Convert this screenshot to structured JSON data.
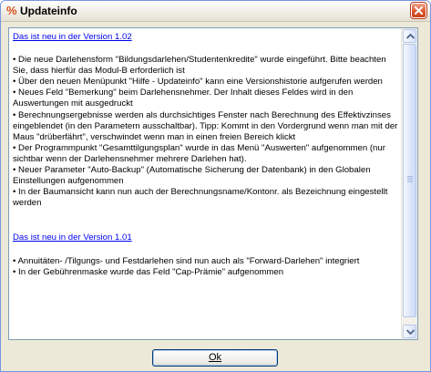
{
  "window": {
    "title": "Updateinfo",
    "app_icon": "percent-icon",
    "close_icon": "close-icon"
  },
  "content": {
    "sections": [
      {
        "heading": "Das ist neu in der Version 1.02",
        "items": [
          "• Die neue Darlehensform \"Bildungsdarlehen/Studentenkredite\" wurde eingeführt. Bitte beachten Sie, dass hierfür das Modul-B erforderlich ist",
          "• Über den neuen Menüpunkt \"Hilfe - Updateinfo\" kann eine Versionshistorie aufgerufen werden",
          "• Neues Feld \"Bemerkung\" beim Darlehensnehmer. Der Inhalt dieses Feldes wird in den Auswertungen mit ausgedruckt",
          "• Berechnungsergebnisse werden als durchsichtiges Fenster nach Berechnung des Effektivzinses eingeblendet (in den Parametern ausschaltbar). Tipp: Kommt in den Vordergrund wenn man mit der Maus \"drüberfährt\", verschwindet wenn man in einen freien Bereich klickt",
          "• Der Programmpunkt \"Gesamttilgungsplan\" wurde in das Menü \"Auswerten\" aufgenommen (nur sichtbar wenn der Darlehensnehmer mehrere Darlehen hat).",
          "• Neuer Parameter \"Auto-Backup\" (Automatische Sicherung der Datenbank) in den Globalen Einstellungen aufgenommen",
          "• In der Baumansicht kann nun auch der Berechnungsname/Kontonr. als Bezeichnung eingestellt werden"
        ]
      },
      {
        "heading": "Das ist neu in der Version 1.01",
        "items": [
          "• Annuitäten- /Tilgungs- und Festdarlehen sind nun auch als \"Forward-Darlehen\" integriert",
          "• In der Gebührenmaske wurde das Feld \"Cap-Prämie\" aufgenommen"
        ]
      }
    ]
  },
  "buttons": {
    "ok_label": "Ok"
  },
  "scrollbar": {
    "up_icon": "arrow-up-icon",
    "down_icon": "arrow-down-icon"
  }
}
